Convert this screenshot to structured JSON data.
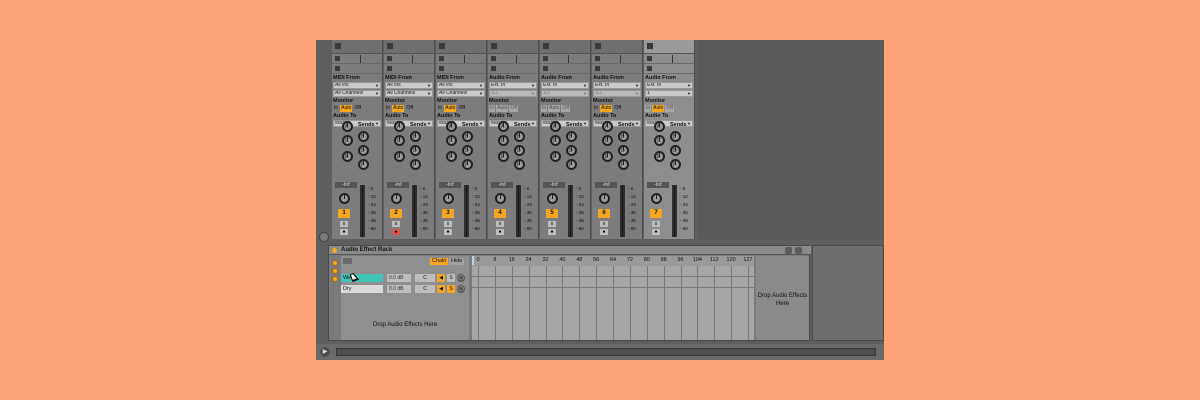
{
  "tracks": [
    {
      "num": "1",
      "io_label": "MIDI From",
      "input": "All Ins",
      "channel": "All Channels",
      "channel_dim": false,
      "monitor_label": "Monitor",
      "mon": [
        "In",
        "Auto",
        "Off"
      ],
      "mon_state": [
        0,
        1,
        0
      ],
      "out_label": "Audio To",
      "output": "Master",
      "sends_label": "Sends",
      "volume": "-Inf",
      "scale": [
        "0",
        "12",
        "24",
        "36",
        "48",
        "60"
      ],
      "solo": "S",
      "arm": "●",
      "arm_red": false
    },
    {
      "num": "2",
      "io_label": "MIDI From",
      "input": "All Ins",
      "channel": "All Channels",
      "channel_dim": false,
      "monitor_label": "Monitor",
      "mon": [
        "In",
        "Auto",
        "Off"
      ],
      "mon_state": [
        0,
        1,
        0
      ],
      "out_label": "Audio To",
      "output": "Master",
      "sends_label": "Sends",
      "volume": "-Inf",
      "scale": [
        "0",
        "12",
        "24",
        "36",
        "48",
        "60"
      ],
      "solo": "S",
      "arm": "●",
      "arm_red": true
    },
    {
      "num": "3",
      "io_label": "MIDI From",
      "input": "All Ins",
      "channel": "All Channels",
      "channel_dim": false,
      "monitor_label": "Monitor",
      "mon": [
        "In",
        "Auto",
        "Off"
      ],
      "mon_state": [
        0,
        1,
        0
      ],
      "out_label": "Audio To",
      "output": "Master",
      "sends_label": "Sends",
      "volume": "-Inf",
      "scale": [
        "0",
        "12",
        "24",
        "36",
        "48",
        "60"
      ],
      "solo": "S",
      "arm": "●",
      "arm_red": false
    },
    {
      "num": "4",
      "io_label": "Audio From",
      "input": "Ext. In",
      "channel": "1/2",
      "channel_dim": true,
      "monitor_label": "Monitor",
      "mon": [
        "In",
        "Auto",
        "Off"
      ],
      "mon_state": [
        2,
        2,
        2
      ],
      "out_label": "Audio To",
      "output": "Master",
      "sends_label": "Sends",
      "volume": "-Inf",
      "scale": [
        "0",
        "12",
        "24",
        "36",
        "48",
        "60"
      ],
      "solo": "S",
      "arm": "●",
      "arm_red": false
    },
    {
      "num": "5",
      "io_label": "Audio From",
      "input": "Ext. In",
      "channel": "1/2",
      "channel_dim": true,
      "monitor_label": "Monitor",
      "mon": [
        "In",
        "Auto",
        "Off"
      ],
      "mon_state": [
        2,
        2,
        2
      ],
      "out_label": "Audio To",
      "output": "Master",
      "sends_label": "Sends",
      "volume": "-Inf",
      "scale": [
        "0",
        "12",
        "24",
        "36",
        "48",
        "60"
      ],
      "solo": "S",
      "arm": "●",
      "arm_red": false
    },
    {
      "num": "6",
      "io_label": "Audio From",
      "input": "Ext. In",
      "channel": "1/2",
      "channel_dim": true,
      "monitor_label": "Monitor",
      "mon": [
        "In",
        "Auto",
        "Off"
      ],
      "mon_state": [
        0,
        1,
        0
      ],
      "out_label": "Audio To",
      "output": "Master",
      "sends_label": "Sends",
      "volume": "-Inf",
      "scale": [
        "0",
        "12",
        "24",
        "36",
        "48",
        "60"
      ],
      "solo": "S",
      "arm": "●",
      "arm_red": false
    },
    {
      "num": "7",
      "io_label": "Audio From",
      "input": "Ext. In",
      "channel": "1",
      "channel_dim": false,
      "monitor_label": "Monitor",
      "mon": [
        "In",
        "Auto",
        "Off"
      ],
      "mon_state": [
        2,
        1,
        2
      ],
      "out_label": "Audio To",
      "output": "Master",
      "sends_label": "Sends",
      "volume": "-Inf",
      "scale": [
        "0",
        "12",
        "24",
        "36",
        "48",
        "60"
      ],
      "solo": "S",
      "arm": "●",
      "arm_red": false
    }
  ],
  "send_labels": [
    "A",
    "B",
    "C",
    "D",
    "E",
    "F"
  ],
  "rack": {
    "title": "Audio Effect Rack",
    "chain_btn": "Chain",
    "hide_btn": "Hide",
    "chains": [
      {
        "name": "Wet",
        "vol": "0.0 dB",
        "pan": "C",
        "selected": true
      },
      {
        "name": "Dry",
        "vol": "0.0 dB",
        "pan": "C",
        "selected": false
      }
    ],
    "chain_mini": [
      "◀",
      "S",
      "◯"
    ],
    "drop_fx": "Drop Audio Effects Here",
    "zone_ticks": [
      "0",
      "8",
      "16",
      "24",
      "32",
      "40",
      "48",
      "56",
      "64",
      "72",
      "80",
      "88",
      "96",
      "104",
      "112",
      "120",
      "127"
    ],
    "drop_audio": "Drop Audio Effects Here"
  },
  "colors": {
    "accent": "#f5a623",
    "selected_chain": "#41c6b6",
    "background": "#fba477"
  }
}
